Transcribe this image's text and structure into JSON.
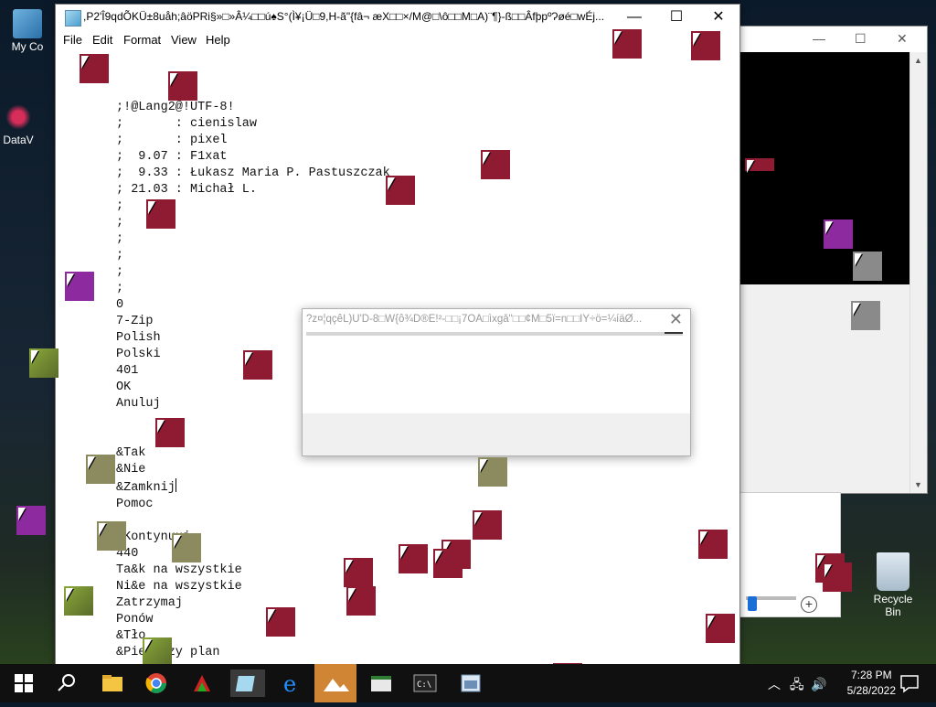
{
  "desktop": {
    "icons": [
      {
        "label": "My Co"
      },
      {
        "label": "DataV"
      },
      {
        "label": "Recycle Bin"
      }
    ]
  },
  "notepad": {
    "title": ",P2'Î9qdÕKÜ±8uåh;âöPRi§»□»Â¼□□ú♠S°(Ì¥¡Ü□9,H-ã\"{fâ¬ æX□□×/M@□\\ô□□M□A)¨¶}-ß□□ÂfþpºɁøé□wÉj...",
    "menu": [
      "File",
      "Edit",
      "Format",
      "View",
      "Help"
    ],
    "lines": [
      ";!@Lang2@!UTF-8!",
      ";       : cienislaw",
      ";       : pixel",
      ";  9.07 : F1xat",
      ";  9.33 : Łukasz Maria P. Pastuszczak",
      "; 21.03 : Michał L.",
      ";",
      ";",
      ";",
      ";",
      ";",
      ";",
      "0",
      "7-Zip",
      "Polish",
      "Polski",
      "401",
      "OK",
      "Anuluj",
      "",
      "",
      "&Tak",
      "&Nie",
      "&Zamknij",
      "Pomoc",
      "",
      "&Kontynuuj",
      "440",
      "Ta&k na wszystkie",
      "Ni&e na wszystkie",
      "Zatrzymaj",
      "Ponów",
      "&Tło",
      "&Pierwszy plan"
    ]
  },
  "dialog": {
    "title": "?z¤¦qçêL)Ù'D-8□W{ô¾D®Ê!²-□□¡7ÕÂ□ìxgå\"□□¢M□5ï=n□□ÍÝ÷ö=¼íäØ...",
    "close": "✕"
  },
  "backwindow": {
    "minimize": "—",
    "maximize": "☐",
    "close": "✕"
  },
  "taskbar": {
    "time": "7:28 PM",
    "date": "5/28/2022"
  },
  "colors": {
    "artifact": "#8e1b31",
    "taskbar": "#101010",
    "accent": "#1a6fd6"
  }
}
